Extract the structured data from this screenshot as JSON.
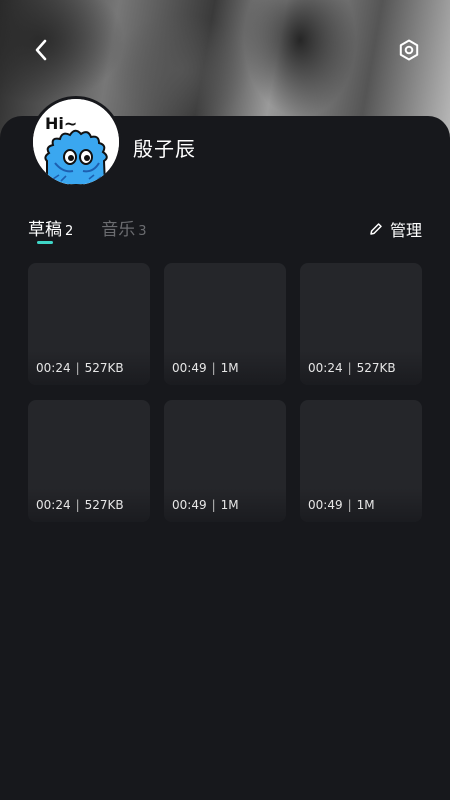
{
  "header": {
    "back_icon": "chevron-left-icon",
    "settings_icon": "hexagon-gear-icon"
  },
  "profile": {
    "name": "殷子辰",
    "avatar_text": "Hi~"
  },
  "tabs": [
    {
      "label": "草稿",
      "count": "2",
      "active": true
    },
    {
      "label": "音乐",
      "count": "3",
      "active": false
    }
  ],
  "manage": {
    "label": "管理",
    "icon": "pencil-icon"
  },
  "accent_color": "#3fd6c7",
  "drafts": [
    {
      "duration": "00:24",
      "size": "527KB"
    },
    {
      "duration": "00:49",
      "size": "1M"
    },
    {
      "duration": "00:24",
      "size": "527KB"
    },
    {
      "duration": "00:24",
      "size": "527KB"
    },
    {
      "duration": "00:49",
      "size": "1M"
    },
    {
      "duration": "00:49",
      "size": "1M"
    }
  ]
}
